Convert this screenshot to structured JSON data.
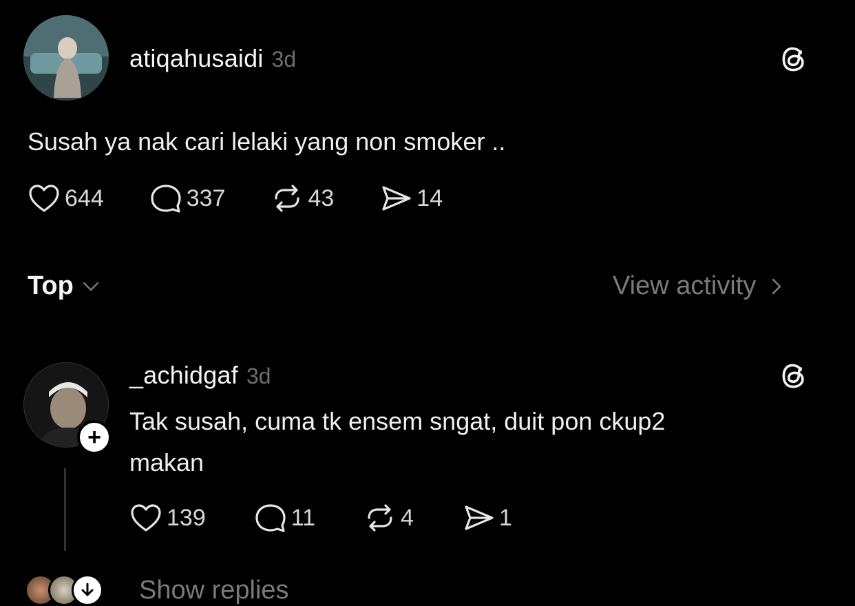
{
  "post": {
    "username": "atiqahusaidi",
    "time": "3d",
    "text": "Susah ya nak cari lelaki yang non smoker ..",
    "likes": "644",
    "comments": "337",
    "reposts": "43",
    "shares": "14"
  },
  "sort": {
    "label": "Top",
    "view_activity": "View activity"
  },
  "reply": {
    "username": "_achidgaf",
    "time": "3d",
    "text_line1": "Tak susah, cuma tk ensem sngat, duit pon ckup2",
    "text_line2": "makan",
    "likes": "139",
    "comments": "11",
    "reposts": "4",
    "shares": "1",
    "follow_label": "+"
  },
  "show_replies": "Show replies",
  "colors": {
    "background": "#000000",
    "text": "#f2f2f2",
    "muted": "#6e6e6e"
  }
}
